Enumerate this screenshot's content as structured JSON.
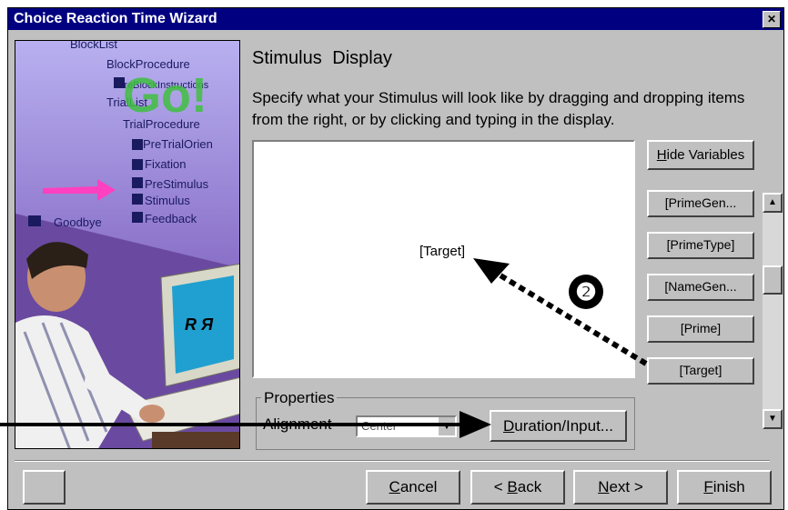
{
  "window": {
    "title": "Choice Reaction Time Wizard"
  },
  "side_image": {
    "tree_items": [
      "BlockList",
      "BlockProcedure",
      "PreBlockInstructions",
      "TrialList",
      "TrialProcedure",
      "PreTrialOrien",
      "Fixation",
      "PreStimulus",
      "Stimulus",
      "Feedback",
      "Goodbye"
    ],
    "go_text": "Go!",
    "monitor_text": "R Я"
  },
  "main": {
    "heading": "Stimulus  Display",
    "instructions": "Specify what your  Stimulus will look like by dragging and dropping items from the right, or by clicking and typing in the display.",
    "display_text": "[Target]"
  },
  "variables": {
    "hide_button": "Hide Variables",
    "hide_button_key": "H",
    "hide_button_rest": "ide Variables",
    "items": [
      "[PrimeGen...",
      "[PrimeType]",
      "[NameGen...",
      "[Prime]",
      "[Target]"
    ]
  },
  "properties": {
    "group_label": "Properties",
    "alignment_label": "Alignment",
    "alignment_value": "Center",
    "duration_button_key": "D",
    "duration_button_rest": "uration/Input..."
  },
  "footer": {
    "cancel_key": "C",
    "cancel_rest": "ancel",
    "back_prefix": "< ",
    "back_key": "B",
    "back_rest": "ack",
    "next_key": "N",
    "next_rest": "ext >",
    "finish_key": "F",
    "finish_rest": "inish"
  },
  "annotation": {
    "step_number": "❷"
  },
  "colors": {
    "titlebar": "#000080",
    "dialog_bg": "#c0c0c0",
    "arrow_pink": "#ff40c0"
  }
}
